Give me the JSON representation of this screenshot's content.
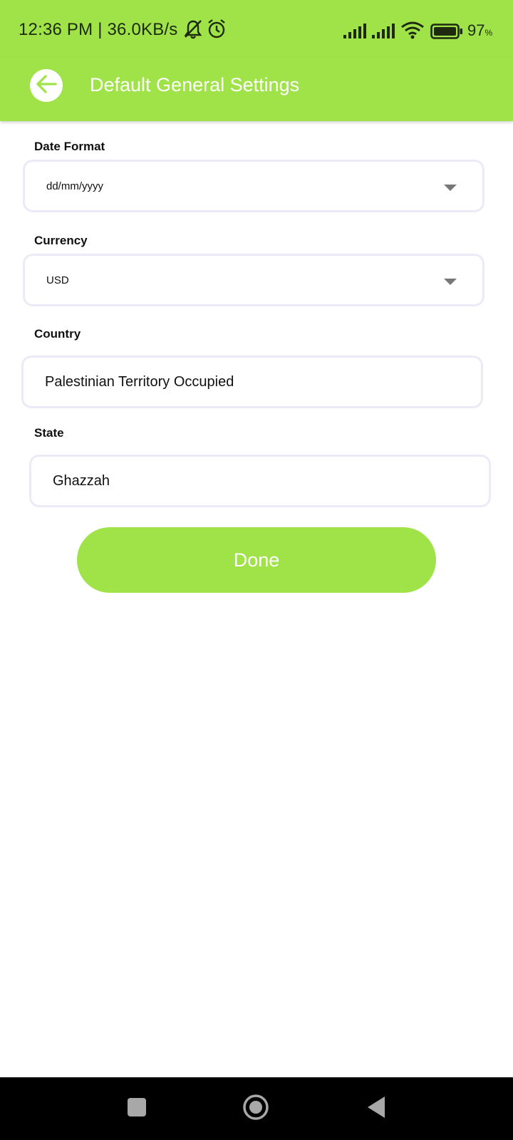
{
  "status_bar": {
    "time": "12:36 PM | 36.0KB/s",
    "battery": "97",
    "battery_unit": "%"
  },
  "icons": {
    "status": [
      "mute-bell-icon",
      "alarm-icon",
      "signal-icon",
      "signal-icon",
      "wifi-icon",
      "battery-icon"
    ],
    "app_bar": [
      "back-arrow-icon"
    ],
    "nav": [
      "recents-square-icon",
      "home-circle-icon",
      "back-triangle-icon"
    ]
  },
  "colors": {
    "accent": "#9fe348",
    "field_border": "#ebebf7",
    "nav_bg": "#000000"
  },
  "header": {
    "title": "Default General Settings"
  },
  "form": {
    "date_format": {
      "label": "Date Format",
      "value": "dd/mm/yyyy"
    },
    "currency": {
      "label": "Currency",
      "value": "USD"
    },
    "country": {
      "label": "Country",
      "value": "Palestinian Territory Occupied"
    },
    "state": {
      "label": "State",
      "value": "Ghazzah"
    },
    "done_label": "Done"
  }
}
